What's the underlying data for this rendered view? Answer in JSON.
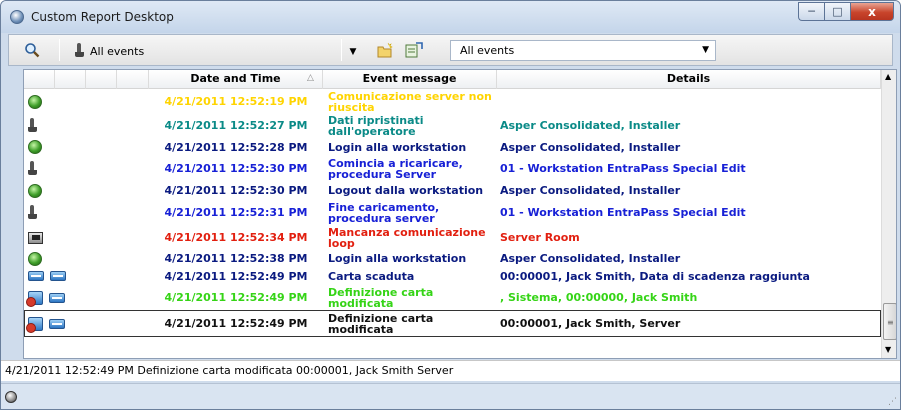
{
  "window": {
    "title": "Custom Report Desktop",
    "controls": {
      "minimize": "─",
      "maximize": "□",
      "close": "x"
    }
  },
  "toolbar": {
    "filter_label": "All events",
    "dropdown_arrow": "▼",
    "select_value": "All events",
    "select_arrow": "▼"
  },
  "grid": {
    "columns": [
      "Date and Time",
      "Event message",
      "Details"
    ],
    "sort_indicator": "△",
    "rows": [
      {
        "icons": [
          "green-status-icon"
        ],
        "date": "4/21/2011 12:52:19 PM",
        "message": "Comunicazione server non riuscita",
        "details": "",
        "color": "#ffd400"
      },
      {
        "icons": [
          "fingerprint-icon"
        ],
        "date": "4/21/2011 12:52:27 PM",
        "message": "Dati ripristinati dall'operatore",
        "details": "Asper Consolidated, Installer",
        "color": "#0a8a87"
      },
      {
        "icons": [
          "green-status-icon"
        ],
        "date": "4/21/2011 12:52:28 PM",
        "message": "Login alla workstation",
        "details": "Asper Consolidated, Installer",
        "color": "#0a1a80"
      },
      {
        "icons": [
          "fingerprint-icon"
        ],
        "date": "4/21/2011 12:52:30 PM",
        "message": "Comincia a ricaricare, procedura Server",
        "details": "01 - Workstation EntraPass Special Edit",
        "color": "#1720d6"
      },
      {
        "icons": [
          "green-status-icon"
        ],
        "date": "4/21/2011 12:52:30 PM",
        "message": "Logout dalla workstation",
        "details": "Asper Consolidated, Installer",
        "color": "#0a1a80"
      },
      {
        "icons": [
          "fingerprint-icon"
        ],
        "date": "4/21/2011 12:52:31 PM",
        "message": "Fine caricamento, procedura server",
        "details": "01 - Workstation EntraPass Special Edit",
        "color": "#1720d6"
      },
      {
        "icons": [
          "monitor-icon"
        ],
        "date": "4/21/2011 12:52:34 PM",
        "message": "Mancanza comunicazione loop",
        "details": "Server Room",
        "color": "#e21f0f"
      },
      {
        "icons": [
          "green-status-icon"
        ],
        "date": "4/21/2011 12:52:38 PM",
        "message": "Login alla workstation",
        "details": "Asper Consolidated, Installer",
        "color": "#0a1a80"
      },
      {
        "icons": [
          "card-icon",
          "card-icon"
        ],
        "date": "4/21/2011 12:52:49 PM",
        "message": "Carta scaduta",
        "details": "00:00001, Jack Smith, Data di scadenza raggiunta",
        "color": "#0a1a80"
      },
      {
        "icons": [
          "card-edit-icon",
          "card-icon"
        ],
        "date": "4/21/2011 12:52:49 PM",
        "message": "Definizione carta modificata",
        "details": ", Sistema, 00:00000, Jack Smith",
        "color": "#35d416"
      },
      {
        "icons": [
          "card-edit-icon",
          "card-icon"
        ],
        "date": "4/21/2011 12:52:49 PM",
        "message": "Definizione carta modificata",
        "details": "00:00001, Jack Smith, Server",
        "color": "#111111",
        "selected": true
      }
    ]
  },
  "scrollbar": {
    "up": "▲",
    "grip": "≡",
    "down": "▼"
  },
  "detail_line": "4/21/2011 12:52:49 PM  Definizione carta modificata  00:00001, Jack Smith  Server",
  "statusbar": {
    "grip": "⋰"
  }
}
